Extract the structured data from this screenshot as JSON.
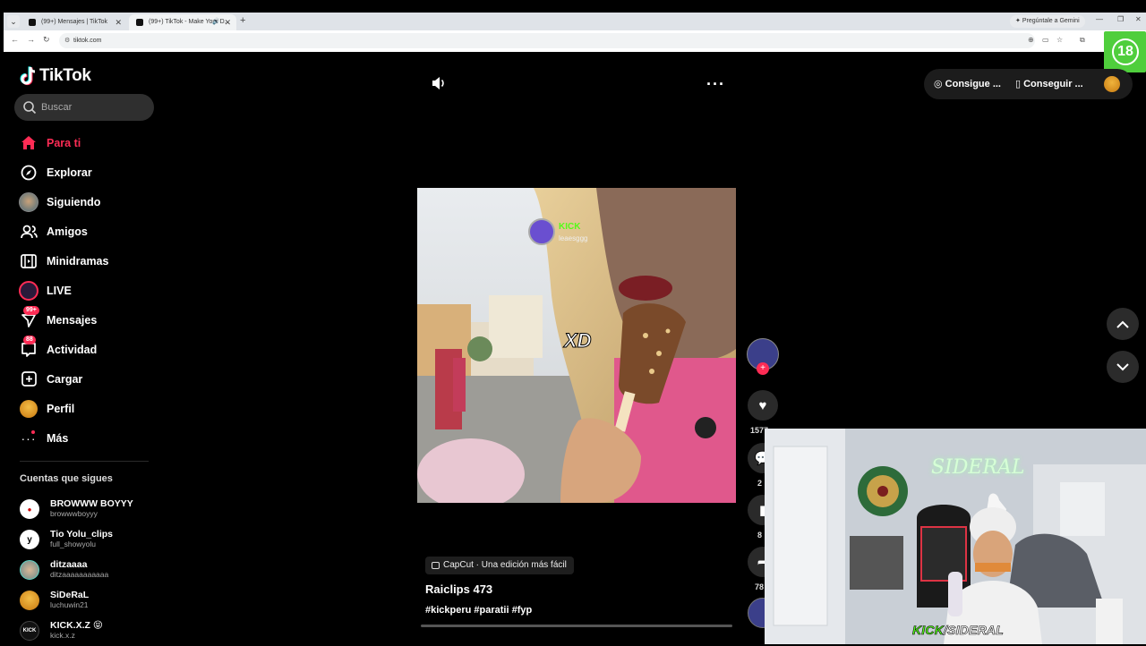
{
  "browser": {
    "tabs": [
      {
        "title": "(99+) Mensajes | TikTok",
        "active": false
      },
      {
        "title": "(99+) TikTok - Make Your D...",
        "active": true
      }
    ],
    "gemini_label": "Pregúntale a Gemini",
    "url": "tiktok.com"
  },
  "age_badge": "18",
  "sidebar": {
    "logo": "TikTok",
    "search_placeholder": "Buscar",
    "nav": [
      {
        "label": "Para ti",
        "icon": "home-icon",
        "active": true
      },
      {
        "label": "Explorar",
        "icon": "compass-icon"
      },
      {
        "label": "Siguiendo",
        "icon": "following-avatar-icon"
      },
      {
        "label": "Amigos",
        "icon": "friends-icon"
      },
      {
        "label": "Minidramas",
        "icon": "film-icon"
      },
      {
        "label": "LIVE",
        "icon": "live-icon"
      },
      {
        "label": "Mensajes",
        "icon": "messages-icon",
        "badge": "99+"
      },
      {
        "label": "Actividad",
        "icon": "activity-icon",
        "badge": "88"
      },
      {
        "label": "Cargar",
        "icon": "upload-icon"
      },
      {
        "label": "Perfil",
        "icon": "profile-avatar-icon"
      },
      {
        "label": "Más",
        "icon": "more-dots-icon"
      }
    ],
    "following_title": "Cuentas que sigues",
    "following": [
      {
        "name": "BROWWW BOYYY",
        "handle": "browwwboyyy"
      },
      {
        "name": "Tio Yolu_clips",
        "handle": "full_showyolu"
      },
      {
        "name": "ditzaaaa",
        "handle": "ditzaaaaaaaaaaa"
      },
      {
        "name": "SiDeRaL",
        "handle": "luchuwin21"
      },
      {
        "name": "KICK.X.Z 😝",
        "handle": "kick.x.z"
      }
    ]
  },
  "top_actions": {
    "btn1": "Consigue ...",
    "btn2": "Conseguir ..."
  },
  "video": {
    "overlay_text": "XD",
    "kick_tag": "KICK",
    "kick_user": "leaesggg",
    "capcut_label": "CapCut · Una edición más fácil",
    "title": "Raiclips 473",
    "hashtags": "#kickperu #paratii #fyp"
  },
  "rail": {
    "like_count": "1577",
    "comment_count": "2",
    "save_count": "8",
    "share_count": "78"
  },
  "webcam": {
    "label_kick": "KICK",
    "label_rest": "/SIDERAL",
    "sign": "SIDERAL"
  }
}
